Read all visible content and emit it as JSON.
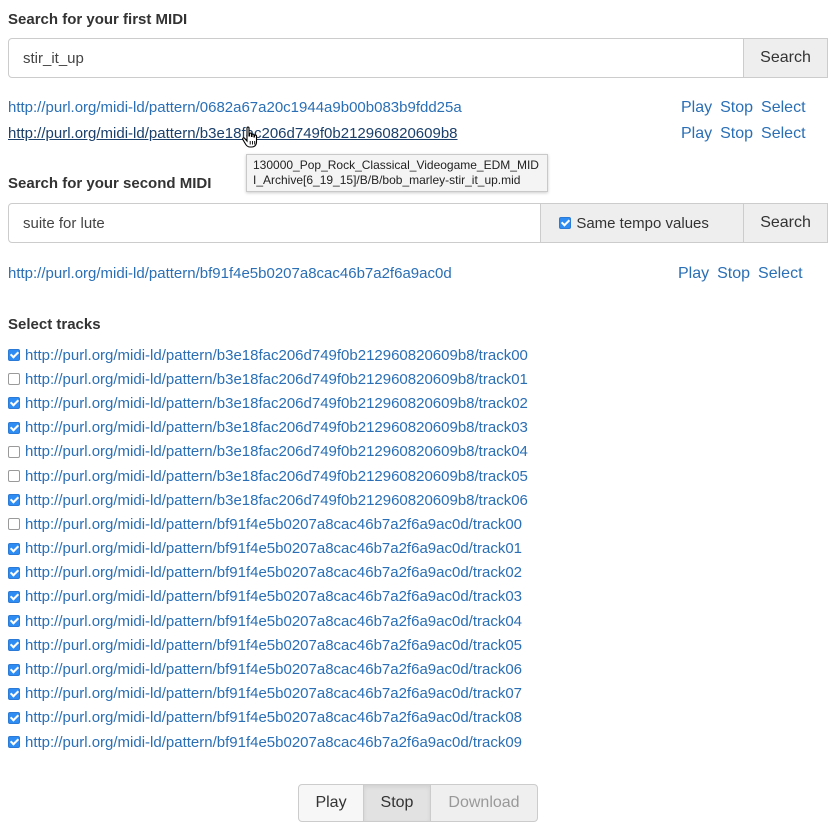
{
  "first_search": {
    "heading": "Search for your first MIDI",
    "query": "stir_it_up",
    "button": "Search",
    "results": [
      {
        "url": "http://purl.org/midi-ld/pattern/0682a67a20c1944a9b00b083b9fdd25a",
        "play": "Play",
        "stop": "Stop",
        "select": "Select"
      },
      {
        "url": "http://purl.org/midi-ld/pattern/b3e18fac206d749f0b212960820609b8",
        "play": "Play",
        "stop": "Stop",
        "select": "Select"
      }
    ],
    "tooltip": "130000_Pop_Rock_Classical_Videogame_EDM_MIDI_Archive[6_19_15]/B/B/bob_marley-stir_it_up.mid"
  },
  "second_search": {
    "heading": "Search for your second MIDI",
    "query": "suite for lute",
    "same_tempo_label": "Same tempo values",
    "same_tempo_checked": true,
    "button": "Search",
    "results": [
      {
        "url": "http://purl.org/midi-ld/pattern/bf91f4e5b0207a8cac46b7a2f6a9ac0d",
        "play": "Play",
        "stop": "Stop",
        "select": "Select"
      }
    ]
  },
  "tracks": {
    "heading": "Select tracks",
    "items": [
      {
        "checked": true,
        "url": "http://purl.org/midi-ld/pattern/b3e18fac206d749f0b212960820609b8/track00"
      },
      {
        "checked": false,
        "url": "http://purl.org/midi-ld/pattern/b3e18fac206d749f0b212960820609b8/track01"
      },
      {
        "checked": true,
        "url": "http://purl.org/midi-ld/pattern/b3e18fac206d749f0b212960820609b8/track02"
      },
      {
        "checked": true,
        "url": "http://purl.org/midi-ld/pattern/b3e18fac206d749f0b212960820609b8/track03"
      },
      {
        "checked": false,
        "url": "http://purl.org/midi-ld/pattern/b3e18fac206d749f0b212960820609b8/track04"
      },
      {
        "checked": false,
        "url": "http://purl.org/midi-ld/pattern/b3e18fac206d749f0b212960820609b8/track05"
      },
      {
        "checked": true,
        "url": "http://purl.org/midi-ld/pattern/b3e18fac206d749f0b212960820609b8/track06"
      },
      {
        "checked": false,
        "url": "http://purl.org/midi-ld/pattern/bf91f4e5b0207a8cac46b7a2f6a9ac0d/track00"
      },
      {
        "checked": true,
        "url": "http://purl.org/midi-ld/pattern/bf91f4e5b0207a8cac46b7a2f6a9ac0d/track01"
      },
      {
        "checked": true,
        "url": "http://purl.org/midi-ld/pattern/bf91f4e5b0207a8cac46b7a2f6a9ac0d/track02"
      },
      {
        "checked": true,
        "url": "http://purl.org/midi-ld/pattern/bf91f4e5b0207a8cac46b7a2f6a9ac0d/track03"
      },
      {
        "checked": true,
        "url": "http://purl.org/midi-ld/pattern/bf91f4e5b0207a8cac46b7a2f6a9ac0d/track04"
      },
      {
        "checked": true,
        "url": "http://purl.org/midi-ld/pattern/bf91f4e5b0207a8cac46b7a2f6a9ac0d/track05"
      },
      {
        "checked": true,
        "url": "http://purl.org/midi-ld/pattern/bf91f4e5b0207a8cac46b7a2f6a9ac0d/track06"
      },
      {
        "checked": true,
        "url": "http://purl.org/midi-ld/pattern/bf91f4e5b0207a8cac46b7a2f6a9ac0d/track07"
      },
      {
        "checked": true,
        "url": "http://purl.org/midi-ld/pattern/bf91f4e5b0207a8cac46b7a2f6a9ac0d/track08"
      },
      {
        "checked": true,
        "url": "http://purl.org/midi-ld/pattern/bf91f4e5b0207a8cac46b7a2f6a9ac0d/track09"
      }
    ]
  },
  "footer_buttons": {
    "play": "Play",
    "stop": "Stop",
    "download": "Download"
  },
  "colors": {
    "link": "#2a6fb5",
    "checkbox": "#2f8cf2",
    "addon_bg": "#eeeeee"
  }
}
